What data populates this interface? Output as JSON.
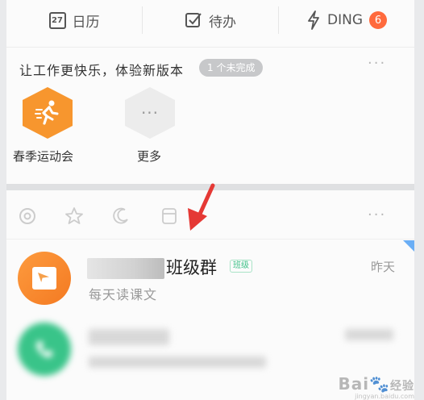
{
  "tabs": [
    {
      "icon": "calendar-icon",
      "day": "27",
      "label": "日历"
    },
    {
      "icon": "checkbox-icon",
      "label": "待办"
    },
    {
      "icon": "lightning-icon",
      "label": "DING",
      "badge": "6"
    }
  ],
  "promo": {
    "title": "让工作更快乐，体验新版本",
    "pill": "1 个未完成",
    "more": "···",
    "apps": [
      {
        "icon": "running-man-icon",
        "label": "春季运动会"
      },
      {
        "icon": "more-dots-icon",
        "glyph": "···",
        "label": "更多"
      }
    ]
  },
  "toolbar": {
    "icons": [
      "at-icon",
      "star-icon",
      "moon-icon",
      "archive-icon"
    ],
    "more": "···"
  },
  "conversations": [
    {
      "avatar_icon": "book-icon",
      "name": "班级群",
      "tag": "班级",
      "time": "昨天",
      "subtitle": "每天读课文",
      "unread_marker": true
    }
  ],
  "colors": {
    "accent_orange": "#f47a22",
    "badge_red": "#ff6a3d",
    "tag_green": "#42c28a",
    "arrow_red": "#e53935",
    "avatar_green": "#39c489"
  },
  "watermark": {
    "text": "Bai",
    "suffix": "经验",
    "sub": "jingyan.baidu.com"
  }
}
